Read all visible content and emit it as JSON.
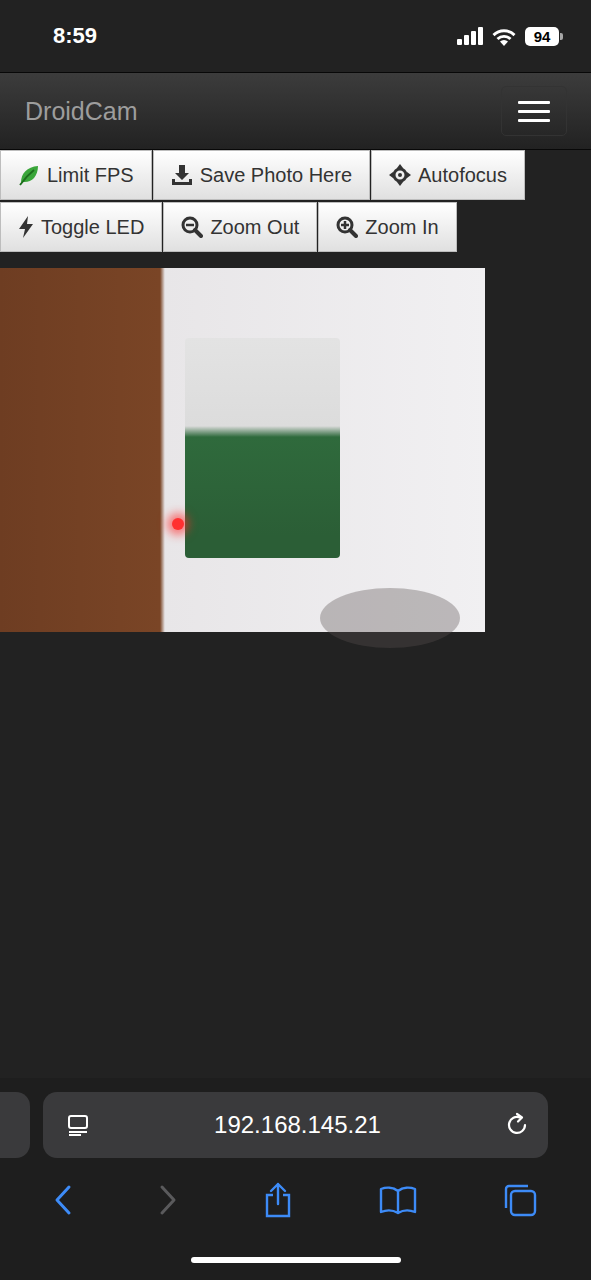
{
  "status_bar": {
    "time": "8:59",
    "battery": "94"
  },
  "navbar": {
    "brand": "DroidCam",
    "menu_expanded": false
  },
  "buttons": [
    {
      "label": "Limit FPS"
    },
    {
      "label": "Save Photo Here"
    },
    {
      "label": "Autofocus"
    },
    {
      "label": "Toggle LED"
    },
    {
      "label": "Zoom Out"
    },
    {
      "label": "Zoom In"
    }
  ],
  "browser": {
    "address": "192.168.145.21",
    "back_enabled": true,
    "forward_enabled": false
  }
}
